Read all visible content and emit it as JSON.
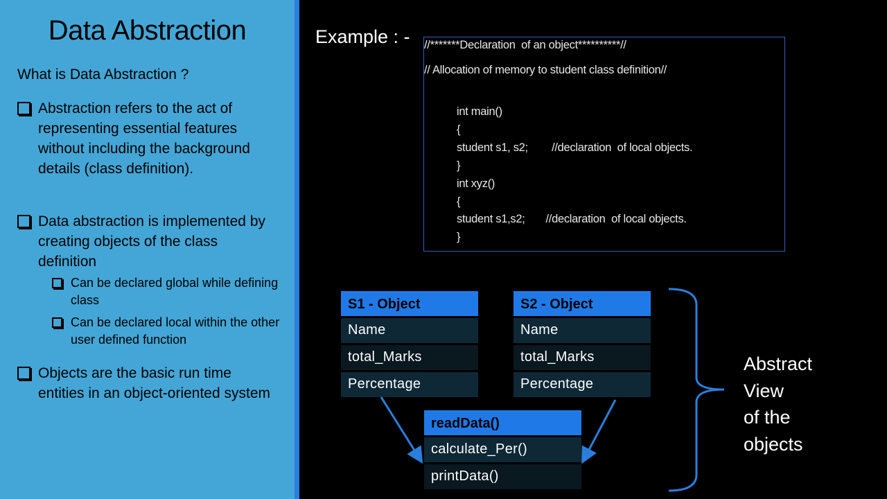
{
  "left": {
    "title": "Data Abstraction",
    "question": "What is Data Abstraction ?",
    "bullets": [
      "Abstraction refers to the act of representing essential features without including the background details (class definition).",
      "Data abstraction is implemented by creating objects of the class definition",
      "Objects are the basic run time entities in an object-oriented system"
    ],
    "sub_bullets": [
      "Can be declared global while defining class",
      "Can be declared local within the other user defined function"
    ]
  },
  "example_label": "Example : -",
  "code": {
    "comment1": "//*******Declaration  of an object**********//",
    "comment2": "// Allocation of memory to student class definition//",
    "lines": [
      "int main()",
      "{",
      "student s1, s2;        //declaration  of local objects.",
      "}",
      "int xyz()",
      "{",
      "student s1,s2;       //declaration  of local objects.",
      "}"
    ]
  },
  "objects": [
    {
      "title": "S1 - Object",
      "fields": [
        "Name",
        "total_Marks",
        "Percentage"
      ]
    },
    {
      "title": "S2 - Object",
      "fields": [
        "Name",
        "total_Marks",
        "Percentage"
      ]
    }
  ],
  "methods": {
    "title": "readData()",
    "items": [
      "calculate_Per()",
      "printData()"
    ]
  },
  "abstract_view": [
    "Abstract",
    "View",
    "of the",
    "objects"
  ],
  "colors": {
    "panel": "#44a6d6",
    "accent": "#1f7ae8"
  }
}
